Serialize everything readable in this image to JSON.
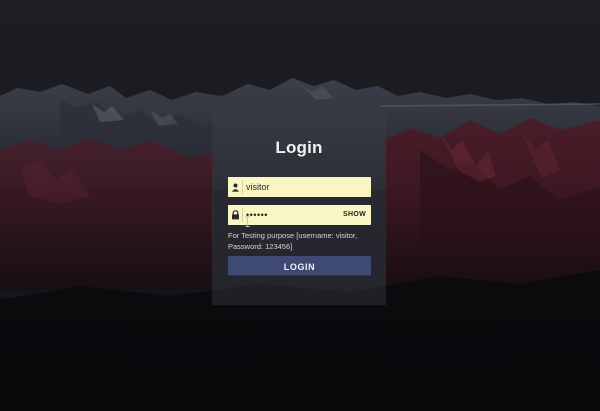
{
  "login": {
    "title": "Login",
    "username": {
      "value": "visitor",
      "icon": "user-icon"
    },
    "password": {
      "value": "••••••",
      "icon": "lock-icon",
      "show_label": "SHOW"
    },
    "hint": "For Testing purpose [username: visitor, Password: 123456]",
    "submit_label": "LOGIN"
  },
  "colors": {
    "field_bg": "#faf6c3",
    "button_bg": "#3e4a73",
    "card_bg": "rgba(60,62,72,0.42)",
    "mountain_red": "#5a2130"
  }
}
